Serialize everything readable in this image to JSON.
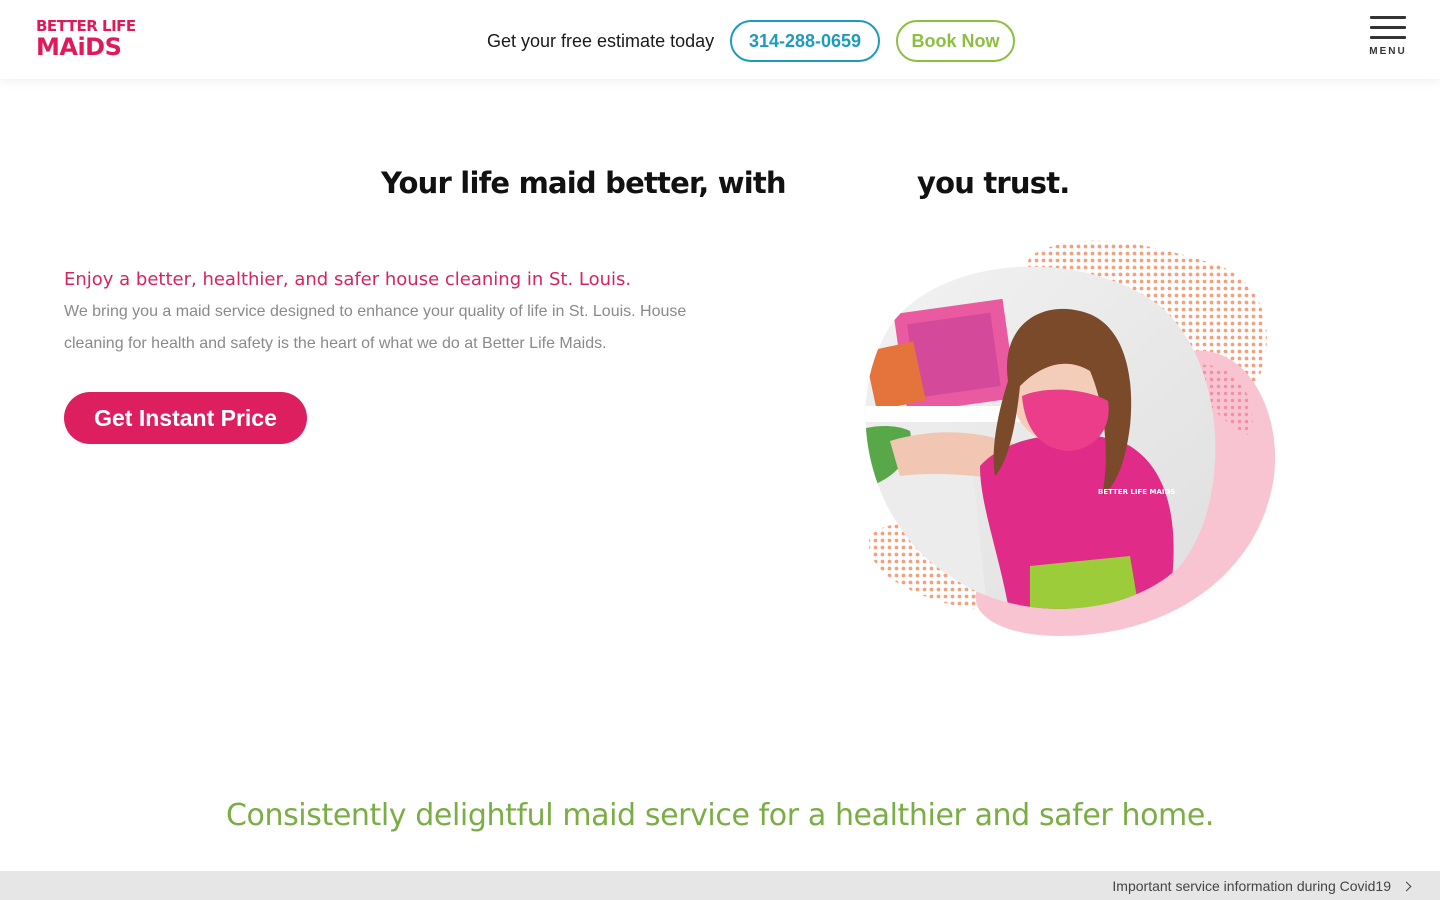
{
  "header": {
    "logo_top": "BETTER LIFE",
    "logo_bottom": "MAiDS",
    "estimate_text": "Get your free estimate today",
    "phone_label": "314-288-0659",
    "book_label": "Book Now",
    "menu_label": "MENU"
  },
  "hero": {
    "headline_part1": "Your life maid better, with",
    "headline_part2": "you trust.",
    "subheading": "Enjoy a better, healthier, and safer house cleaning in St. Louis.",
    "intro": "We bring you a maid service designed to enhance your quality of life in St. Louis. House cleaning for health and safety is the heart of what we do at Better Life Maids.",
    "cta_label": "Get Instant Price",
    "uniform_text": "BETTER LIFE MAIDS"
  },
  "tagline": "Consistently delightful maid service for a healthier and safer home.",
  "footer_bar": {
    "covid_link": "Important service information during Covid19"
  },
  "colors": {
    "brand_pink": "#dd1f5f",
    "brand_blue": "#1d9bbd",
    "brand_green": "#8dbf3f",
    "tagline_green": "#7bad45"
  },
  "icons": [
    "hamburger-menu-icon",
    "chevron-right-icon"
  ]
}
